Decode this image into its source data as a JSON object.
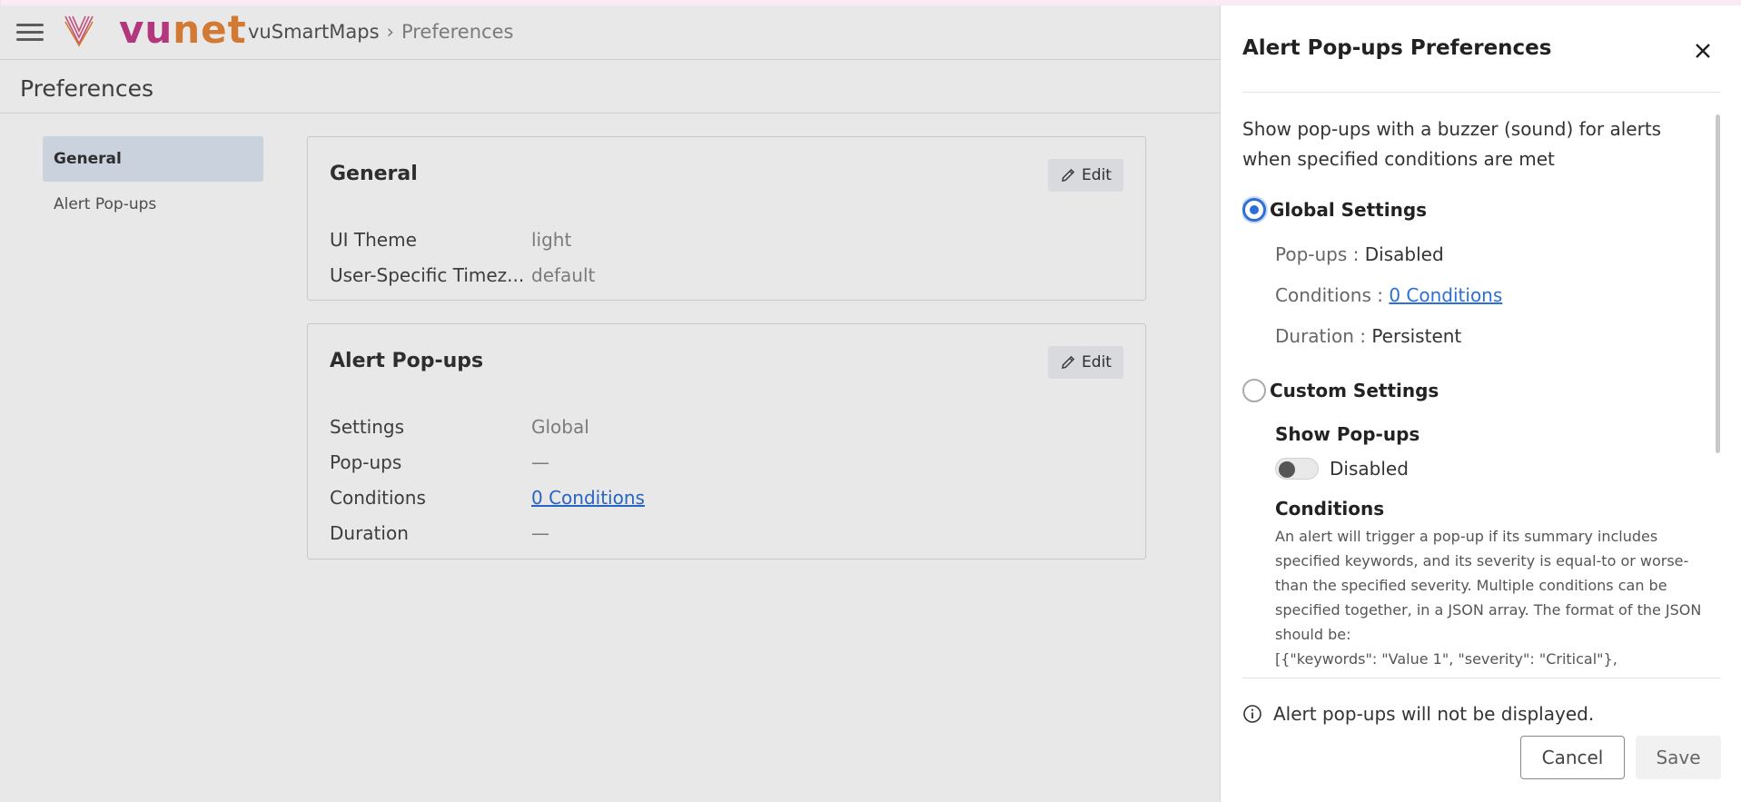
{
  "topbar": {
    "logo_part1": "vu",
    "logo_part2": "net",
    "breadcrumb_root": "vuSmartMaps",
    "breadcrumb_sep": "›",
    "breadcrumb_current": "Preferences"
  },
  "page": {
    "title": "Preferences"
  },
  "nav": {
    "items": [
      {
        "label": "General",
        "active": true
      },
      {
        "label": "Alert Pop-ups",
        "active": false
      }
    ]
  },
  "general_card": {
    "title": "General",
    "edit_label": "Edit",
    "rows": [
      {
        "key": "UI Theme",
        "value": "light"
      },
      {
        "key": "User-Specific Timez...",
        "value": "default"
      }
    ]
  },
  "alert_card": {
    "title": "Alert Pop-ups",
    "edit_label": "Edit",
    "rows": [
      {
        "key": "Settings",
        "value": "Global"
      },
      {
        "key": "Pop-ups",
        "value": "—"
      },
      {
        "key": "Conditions",
        "value": "0 Conditions"
      },
      {
        "key": "Duration",
        "value": "—"
      }
    ]
  },
  "drawer": {
    "title": "Alert Pop-ups Preferences",
    "description": "Show pop-ups with a buzzer (sound) for alerts when specified conditions are met",
    "global": {
      "label": "Global Settings",
      "selected": true,
      "popups_label": "Pop-ups :",
      "popups_value": "Disabled",
      "conditions_label": "Conditions :",
      "conditions_value": "0 Conditions",
      "duration_label": "Duration :",
      "duration_value": "Persistent"
    },
    "custom": {
      "label": "Custom Settings",
      "selected": false,
      "show_popups_heading": "Show Pop-ups",
      "toggle_value": "Disabled",
      "conditions_heading": "Conditions",
      "conditions_text": "An alert will trigger a pop-up if its summary includes specified keywords, and its severity is equal-to or worse-than the specified severity. Multiple conditions can be specified together, in a JSON array. The format of the JSON should be:",
      "json_example": "[{\"keywords\": \"Value 1\", \"severity\": \"Critical\"},"
    },
    "info_message": "Alert pop-ups will not be displayed.",
    "cancel_label": "Cancel",
    "save_label": "Save"
  },
  "colors": {
    "accent": "#2d6fd6",
    "logo_magenta": "#c43d8a",
    "logo_orange": "#e7873a",
    "nav_active_bg": "#dfe7f5"
  }
}
